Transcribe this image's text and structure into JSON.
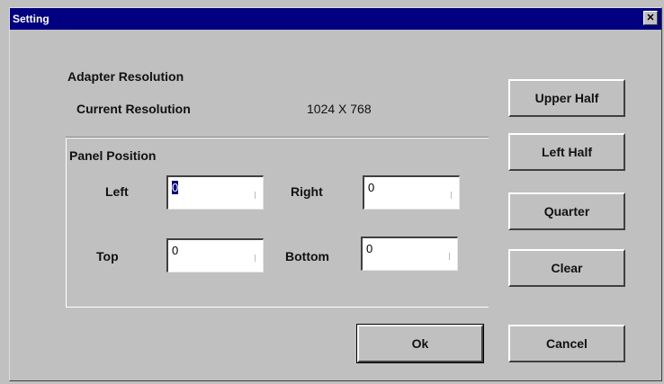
{
  "window": {
    "title": "Setting",
    "close_glyph": "✕"
  },
  "adapter": {
    "heading": "Adapter Resolution",
    "current_label": "Current Resolution",
    "current_value": "1024 X 768"
  },
  "panel": {
    "heading": "Panel Position",
    "left_label": "Left",
    "left_value": "0",
    "right_label": "Right",
    "right_value": "0",
    "top_label": "Top",
    "top_value": "0",
    "bottom_label": "Bottom",
    "bottom_value": "0"
  },
  "buttons": {
    "upper_half": "Upper Half",
    "left_half": "Left Half",
    "quarter": "Quarter",
    "clear": "Clear",
    "ok": "Ok",
    "cancel": "Cancel"
  }
}
